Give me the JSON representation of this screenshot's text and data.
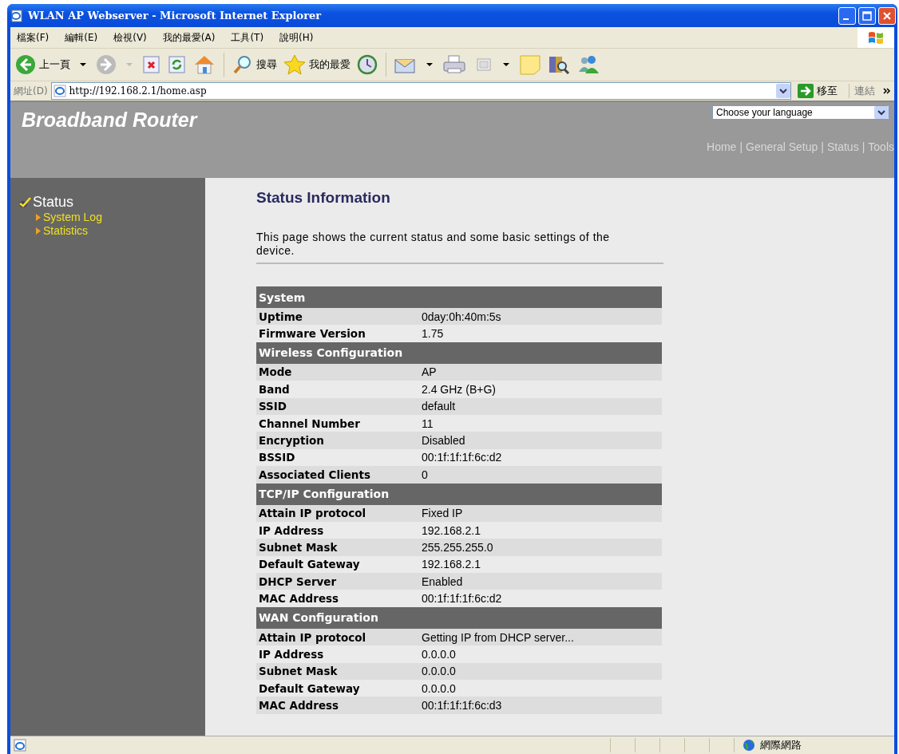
{
  "window": {
    "title": "WLAN AP Webserver - Microsoft Internet Explorer"
  },
  "menu": [
    "檔案(F)",
    "編輯(E)",
    "檢視(V)",
    "我的最愛(A)",
    "工具(T)",
    "說明(H)"
  ],
  "toolbar": {
    "back": "上一頁",
    "search": "搜尋",
    "favorites": "我的最愛"
  },
  "address": {
    "label": "網址(D)",
    "url": "http://192.168.2.1/home.asp",
    "go": "移至",
    "links": "連結"
  },
  "page": {
    "brand": "Broadband Router",
    "language": {
      "value": "Choose your language"
    },
    "nav": [
      {
        "label": "Home",
        "separator": "|"
      },
      {
        "label": "General Setup",
        "separator": "|"
      },
      {
        "label": "Status",
        "separator": "|"
      },
      {
        "label": "Tools"
      }
    ],
    "sidebar": {
      "heading": "Status",
      "items": [
        "System Log",
        "Statistics"
      ]
    },
    "title": "Status Information",
    "description": "This page shows the current status and some basic settings of the device.",
    "sections": [
      {
        "title": "System",
        "rows": [
          [
            "Uptime",
            "0day:0h:40m:5s"
          ],
          [
            "Firmware Version",
            "1.75"
          ]
        ]
      },
      {
        "title": "Wireless Configuration",
        "rows": [
          [
            "Mode",
            "AP"
          ],
          [
            "Band",
            "2.4 GHz (B+G)"
          ],
          [
            "SSID",
            "default"
          ],
          [
            "Channel Number",
            "11"
          ],
          [
            "Encryption",
            "Disabled"
          ],
          [
            "BSSID",
            "00:1f:1f:1f:6c:d2"
          ],
          [
            "Associated Clients",
            "0"
          ]
        ]
      },
      {
        "title": "TCP/IP Configuration",
        "rows": [
          [
            "Attain IP protocol",
            "Fixed IP"
          ],
          [
            "IP Address",
            "192.168.2.1"
          ],
          [
            "Subnet Mask",
            "255.255.255.0"
          ],
          [
            "Default Gateway",
            "192.168.2.1"
          ],
          [
            "DHCP Server",
            "Enabled"
          ],
          [
            "MAC Address",
            "00:1f:1f:1f:6c:d2"
          ]
        ]
      },
      {
        "title": "WAN Configuration",
        "rows": [
          [
            "Attain IP protocol",
            "Getting IP from DHCP server..."
          ],
          [
            "IP Address",
            "0.0.0.0"
          ],
          [
            "Subnet Mask",
            "0.0.0.0"
          ],
          [
            "Default Gateway",
            "0.0.0.0"
          ],
          [
            "MAC Address",
            "00:1f:1f:1f:6c:d3"
          ]
        ]
      }
    ]
  },
  "status_bar": {
    "zone": "網際網路"
  }
}
